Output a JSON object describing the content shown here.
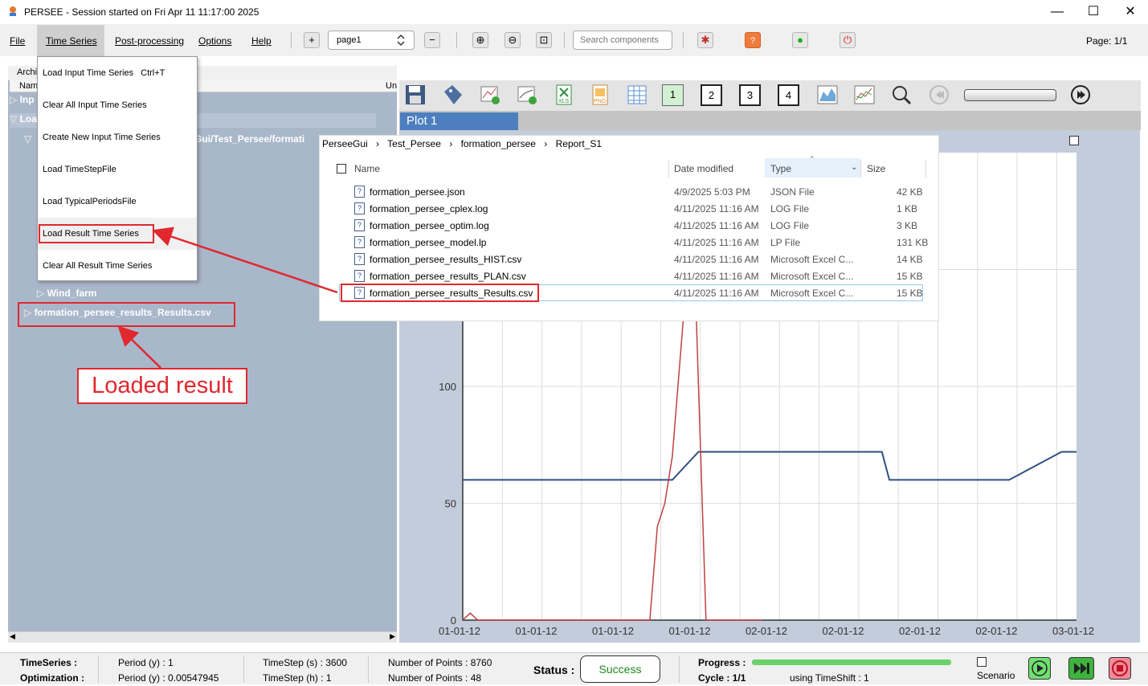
{
  "window": {
    "title": "PERSEE - Session started on Fri Apr 11 11:17:00 2025",
    "minimize": "—",
    "maximize": "☐",
    "close": "✕"
  },
  "menu": {
    "items": [
      "File",
      "Time Series",
      "Post-processing",
      "Options",
      "Help"
    ],
    "page_select": "page1",
    "search_placeholder": "Search components",
    "page_label": "Page: 1/1"
  },
  "dropdown": {
    "items": [
      {
        "label": "Load Input Time Series",
        "shortcut": "Ctrl+T"
      },
      {
        "label": "Clear All Input Time Series",
        "shortcut": ""
      },
      {
        "label": "Create New Input Time Series",
        "shortcut": ""
      },
      {
        "label": "Load TimeStepFile",
        "shortcut": ""
      },
      {
        "label": "Load TypicalPeriodsFile",
        "shortcut": ""
      },
      {
        "label": "Load Result Time Series",
        "shortcut": ""
      },
      {
        "label": "Clear All Result Time Series",
        "shortcut": ""
      }
    ]
  },
  "left": {
    "header_arch": "Archi",
    "header_name": "Nam",
    "header_un": "Un",
    "row_in": "Inp",
    "row_lo": "Loa",
    "path_fragment": "Gui/Test_Persee/formati",
    "wind_farm": "Wind_farm",
    "result_file": "formation_persee_results_Results.csv",
    "annotation": "Loaded result"
  },
  "plot": {
    "tab": "Plot 1",
    "num_buttons": [
      "1",
      "2",
      "3",
      "4"
    ]
  },
  "explorer": {
    "breadcrumb": [
      "PerseeGui",
      "Test_Persee",
      "formation_persee",
      "Report_S1"
    ],
    "columns": {
      "name": "Name",
      "date": "Date modified",
      "type": "Type",
      "size": "Size"
    },
    "files": [
      {
        "name": "formation_persee.json",
        "date": "4/9/2025 5:03 PM",
        "type": "JSON File",
        "size": "42 KB"
      },
      {
        "name": "formation_persee_cplex.log",
        "date": "4/11/2025 11:16 AM",
        "type": "LOG File",
        "size": "1 KB"
      },
      {
        "name": "formation_persee_optim.log",
        "date": "4/11/2025 11:16 AM",
        "type": "LOG File",
        "size": "3 KB"
      },
      {
        "name": "formation_persee_model.lp",
        "date": "4/11/2025 11:16 AM",
        "type": "LP File",
        "size": "131 KB"
      },
      {
        "name": "formation_persee_results_HIST.csv",
        "date": "4/11/2025 11:16 AM",
        "type": "Microsoft Excel C...",
        "size": "14 KB"
      },
      {
        "name": "formation_persee_results_PLAN.csv",
        "date": "4/11/2025 11:16 AM",
        "type": "Microsoft Excel C...",
        "size": "15 KB"
      },
      {
        "name": "formation_persee_results_Results.csv",
        "date": "4/11/2025 11:16 AM",
        "type": "Microsoft Excel C...",
        "size": "15 KB"
      }
    ]
  },
  "chart_data": {
    "type": "line",
    "x_ticks": [
      "01-01-12",
      "01-01-12",
      "01-01-12",
      "01-01-12",
      "02-01-12",
      "02-01-12",
      "02-01-12",
      "02-01-12",
      "03-01-12"
    ],
    "y_ticks": [
      "0",
      "50",
      "100"
    ],
    "series": [
      {
        "color": "#2f4f7f",
        "x": [
          0,
          9.5,
          11,
          19,
          26,
          28,
          31.5,
          33,
          41,
          48,
          50,
          54,
          56,
          57,
          58.5,
          71,
          73,
          80,
          82
        ],
        "y": [
          60,
          60,
          60,
          60,
          60,
          60,
          72,
          72,
          72,
          72,
          72,
          72,
          72,
          60,
          60,
          60,
          60,
          72,
          72
        ]
      },
      {
        "color": "#c04040",
        "x": [
          0,
          1,
          2,
          3,
          10,
          20,
          25,
          26,
          27,
          28,
          29,
          30,
          31,
          31.5,
          32.5,
          40
        ],
        "y": [
          0,
          3,
          0,
          0,
          0,
          0,
          0,
          40,
          50,
          70,
          110,
          150,
          150,
          100,
          0,
          0
        ]
      }
    ]
  },
  "status": {
    "timeseries_label": "TimeSeries :",
    "optimization_label": "Optimization :",
    "period_y1": "Period (y) : 1",
    "period_y2": "Period (y) : 0.00547945",
    "timestep_s": "TimeStep (s) : 3600",
    "timestep_h": "TimeStep (h) : 1",
    "points_1": "Number of Points : 8760",
    "points_2": "Number of Points : 48",
    "status_label": "Status :",
    "status_value": "Success",
    "progress_label": "Progress :",
    "cycle": "Cycle : 1/1",
    "timeshift": "using TimeShift : 1",
    "scenario": "Scenario",
    "progress": 1.0
  },
  "colors": {
    "accent": "#e0282e",
    "tree_bg": "#a9b7ca",
    "plot_tab": "#4d7fbf",
    "success": "#1a8a1a"
  }
}
